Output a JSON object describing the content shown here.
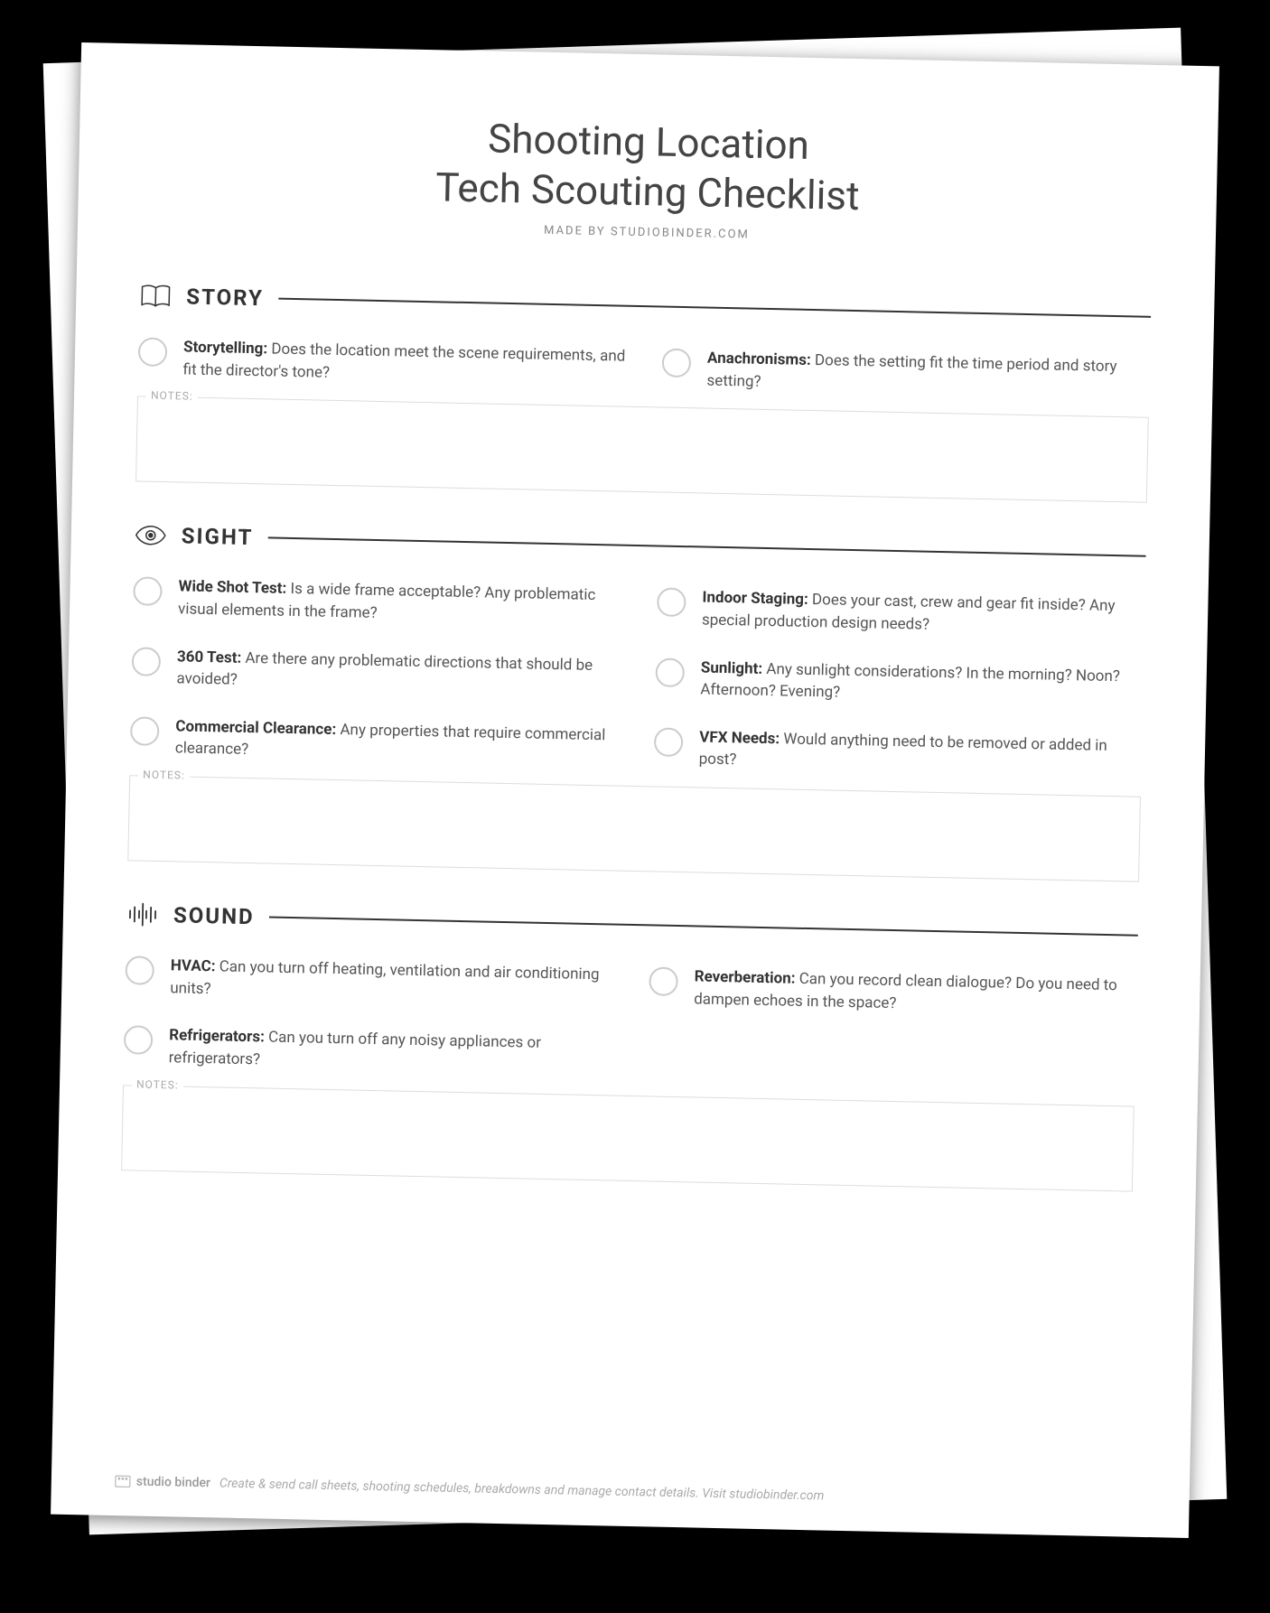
{
  "header": {
    "title_line1": "Shooting Location",
    "title_line2": "Tech Scouting Checklist",
    "subtitle": "MADE BY STUDIOBINDER.COM"
  },
  "sections": {
    "story": {
      "title": "STORY",
      "items": [
        {
          "label": "Storytelling:",
          "desc": "Does the location meet the scene requirements, and fit the director's tone?"
        },
        {
          "label": "Anachronisms:",
          "desc": "Does the setting fit the time period and story setting?"
        }
      ],
      "notes_label": "NOTES:"
    },
    "sight": {
      "title": "SIGHT",
      "items": [
        {
          "label": "Wide Shot Test:",
          "desc": "Is a wide frame acceptable? Any problematic visual elements in the frame?"
        },
        {
          "label": "Indoor Staging:",
          "desc": "Does your cast, crew and gear fit inside? Any special production design needs?"
        },
        {
          "label": "360 Test:",
          "desc": "Are there any problematic directions that should be avoided?"
        },
        {
          "label": "Sunlight:",
          "desc": "Any sunlight considerations? In the morning? Noon? Afternoon? Evening?"
        },
        {
          "label": "Commercial Clearance:",
          "desc": "Any properties that require commercial clearance?"
        },
        {
          "label": "VFX Needs:",
          "desc": "Would anything need to be removed or added in post?"
        }
      ],
      "notes_label": "NOTES:"
    },
    "sound": {
      "title": "SOUND",
      "items": [
        {
          "label": "HVAC:",
          "desc": "Can you turn off heating, ventilation and air conditioning units?"
        },
        {
          "label": "Reverberation:",
          "desc": "Can you record clean dialogue? Do you need to dampen echoes in the space?"
        },
        {
          "label": "Refrigerators:",
          "desc": "Can you turn off any noisy appliances or refrigerators?"
        }
      ],
      "notes_label": "NOTES:"
    }
  },
  "footer": {
    "brand": "studio binder",
    "text": "Create & send call sheets, shooting schedules, breakdowns and manage contact details. Visit studiobinder.com"
  }
}
